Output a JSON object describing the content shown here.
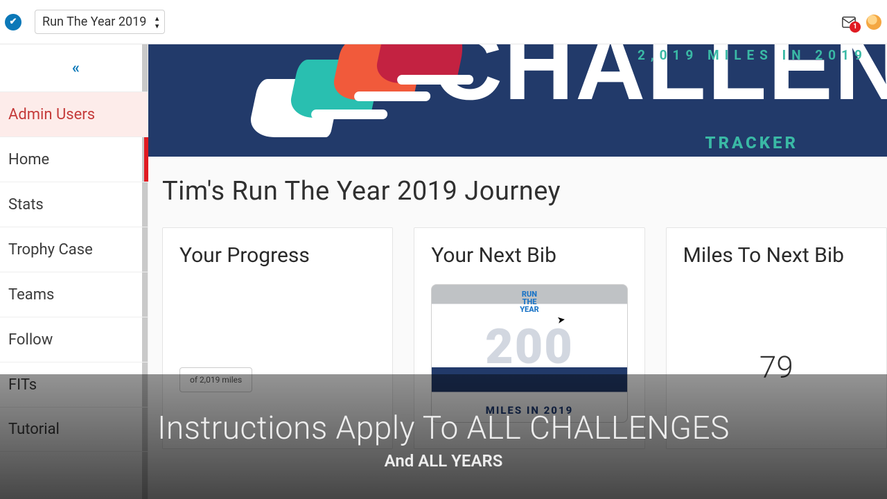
{
  "topbar": {
    "challenge_selected": "Run The Year 2019",
    "notification_count": "1"
  },
  "banner": {
    "word": "CHALLENGE",
    "subline": "2,019 MILES IN 2019",
    "tracker": "TRACKER"
  },
  "sidebar": {
    "items": [
      {
        "label": "Admin Users"
      },
      {
        "label": "Home"
      },
      {
        "label": "Stats"
      },
      {
        "label": "Trophy Case"
      },
      {
        "label": "Teams"
      },
      {
        "label": "Follow"
      },
      {
        "label": "FITs"
      },
      {
        "label": "Tutorial"
      }
    ]
  },
  "page": {
    "title": "Tim's Run The Year 2019 Journey"
  },
  "cards": {
    "progress": {
      "title": "Your Progress",
      "goal_text": "of 2,019 miles"
    },
    "next_bib": {
      "title": "Your Next Bib",
      "logo_line1": "RUN",
      "logo_line2": "THE",
      "logo_line3": "YEAR",
      "big": "200",
      "miles": "MILES IN 2019"
    },
    "miles_to": {
      "title": "Miles To Next Bib",
      "value": "79"
    }
  },
  "overlay": {
    "line1": "Instructions Apply To ALL CHALLENGES",
    "line2": "And ALL YEARS"
  }
}
